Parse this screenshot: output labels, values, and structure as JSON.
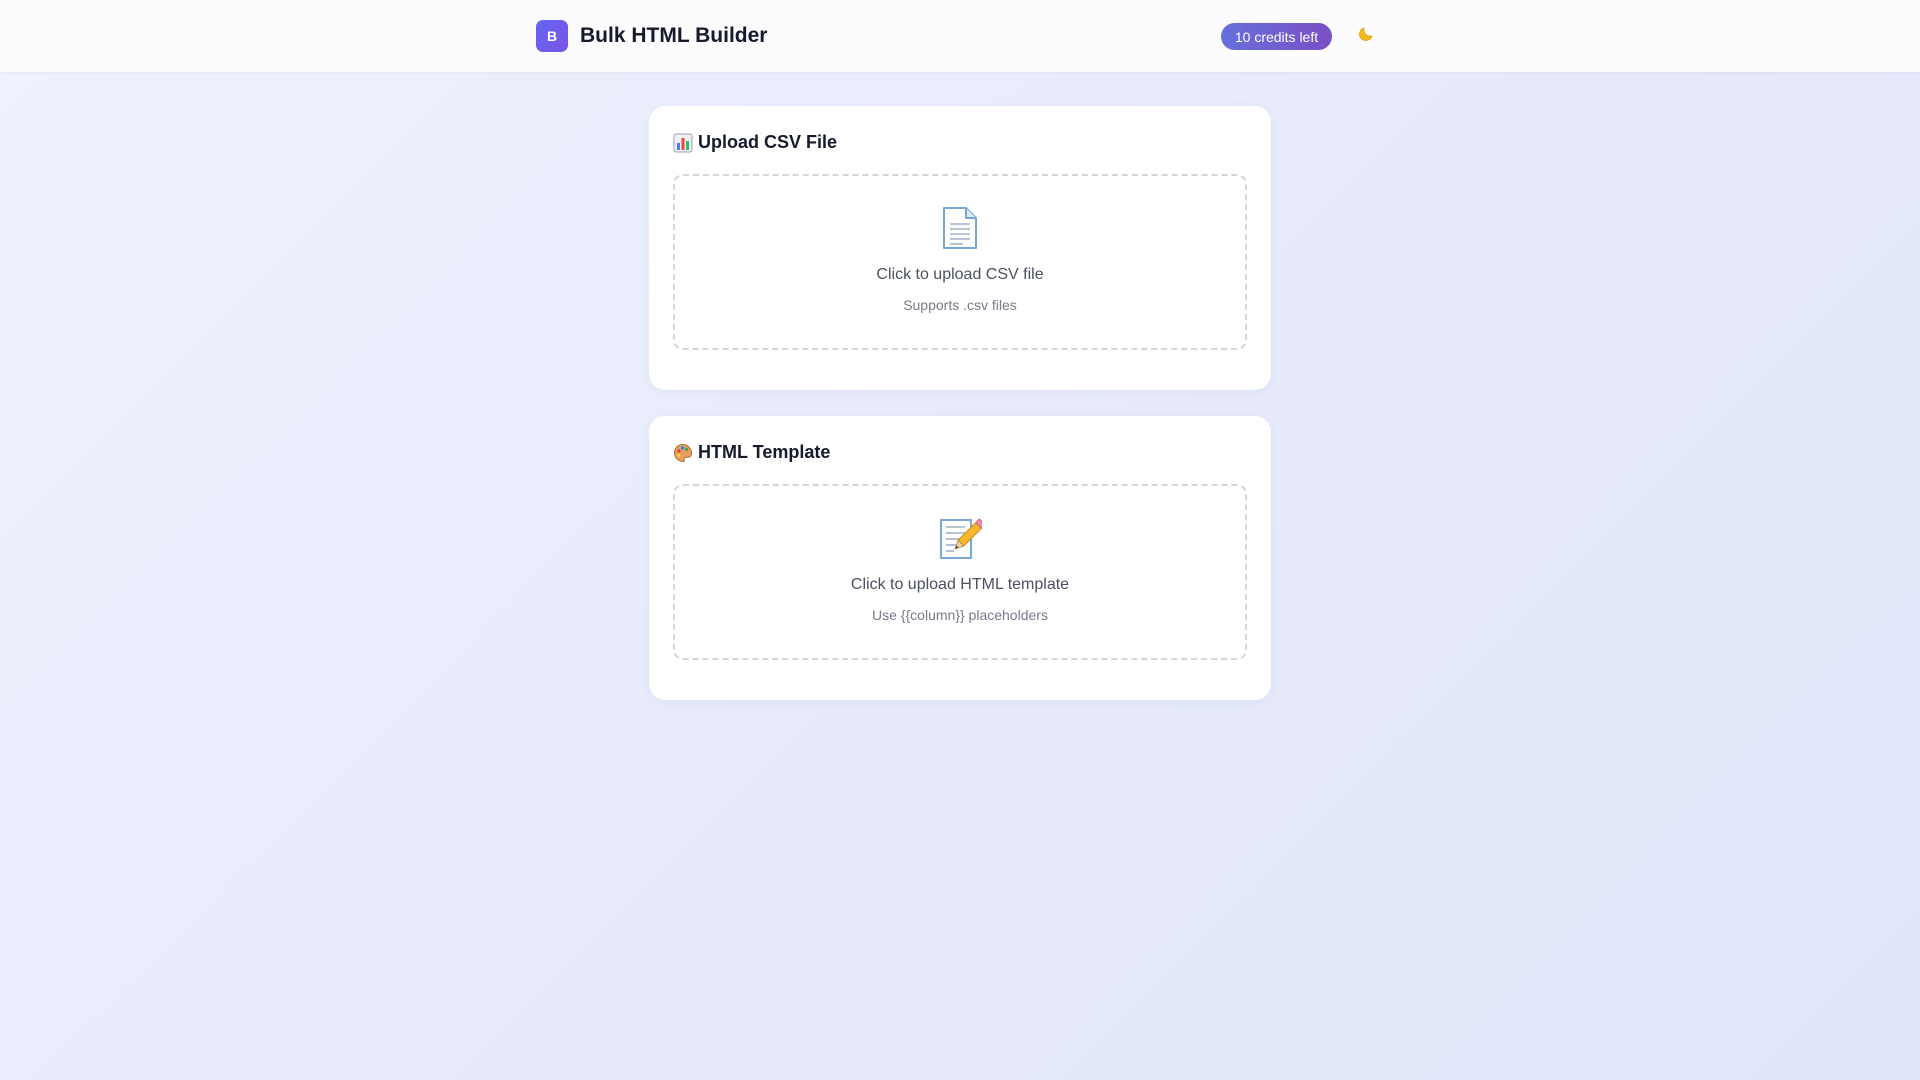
{
  "header": {
    "logo_letter": "B",
    "app_title": "Bulk HTML Builder",
    "credits_badge": "10 credits left",
    "theme_toggle_icon": "moon-icon"
  },
  "csv_card": {
    "title_icon": "bar-chart-icon",
    "title": "Upload CSV File",
    "dropzone": {
      "icon": "document-icon",
      "main_text": "Click to upload CSV file",
      "sub_text": "Supports .csv files"
    }
  },
  "template_card": {
    "title_icon": "palette-icon",
    "title": "HTML Template",
    "dropzone": {
      "icon": "memo-pencil-icon",
      "main_text": "Click to upload HTML template",
      "sub_text": "Use {{column}} placeholders"
    }
  },
  "colors": {
    "accent": "#6366f1",
    "accent_purple": "#7b55e6",
    "badge_start": "#6670dc",
    "badge_end": "#7a4fc4",
    "page_background": "#e8ecfc",
    "card_background": "#ffffff",
    "dropzone_border": "#d4d6dc"
  }
}
